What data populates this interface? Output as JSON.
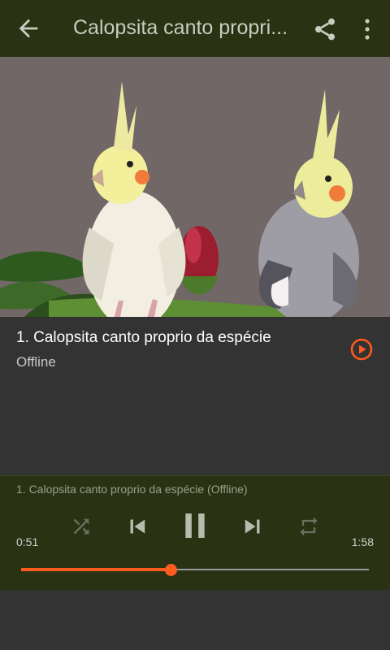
{
  "appbar": {
    "title": "Calopsita canto propri...",
    "icons": {
      "back": "arrow-back-icon",
      "share": "share-icon",
      "more": "more-vert-icon"
    }
  },
  "artwork": {
    "description_icon": "album-art-image"
  },
  "track": {
    "title": "1. Calopsita canto proprio da espécie",
    "status": "Offline"
  },
  "player": {
    "now_playing": "1. Calopsita canto proprio da espécie (Offline)",
    "elapsed": "0:51",
    "total": "1:58",
    "progress": 0.43
  },
  "colors": {
    "accent": "#ff5a1f",
    "bar": "#2a3214",
    "background": "#333333"
  }
}
